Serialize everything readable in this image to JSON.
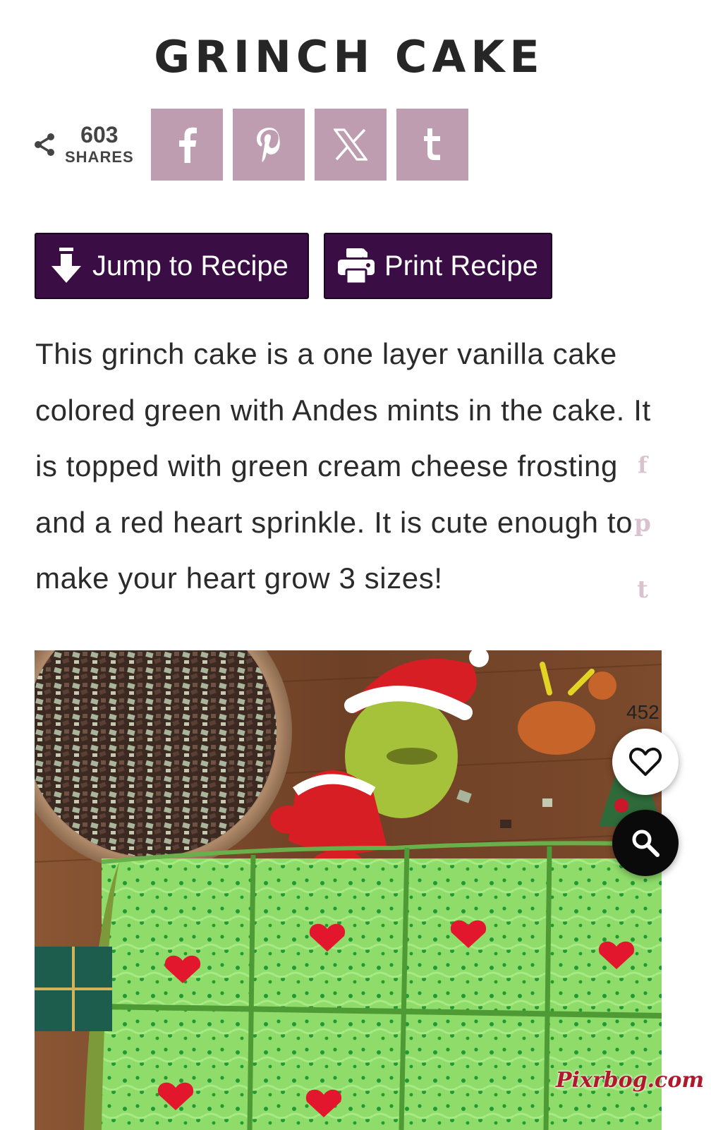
{
  "post": {
    "title": "GRINCH CAKE",
    "intro": "This grinch cake is a one layer vanilla cake colored green with Andes mints in the cake. It is topped with green cream cheese frosting and a red heart sprinkle. It is cute enough to make your heart grow 3 sizes!"
  },
  "share": {
    "count": "603",
    "label": "SHARES",
    "buttons": [
      {
        "network": "facebook",
        "icon": "facebook-icon"
      },
      {
        "network": "pinterest",
        "icon": "pinterest-icon"
      },
      {
        "network": "x",
        "icon": "x-icon"
      },
      {
        "network": "tumblr",
        "icon": "tumblr-icon"
      }
    ],
    "button_color": "#bf9db0"
  },
  "recipe_buttons": {
    "jump_label": "Jump to Recipe",
    "print_label": "Print Recipe",
    "color": "#3a0e45"
  },
  "floating_social": {
    "facebook_glyph": "f",
    "pinterest_glyph": "p",
    "tumblr_glyph": "t"
  },
  "hero_image": {
    "subject": "Grinch cake squares with green frosting and red heart sprinkles",
    "watermark": "Pixrbog.com"
  },
  "actions": {
    "like_count": "452",
    "like_icon": "heart-icon",
    "search_icon": "search-icon"
  }
}
